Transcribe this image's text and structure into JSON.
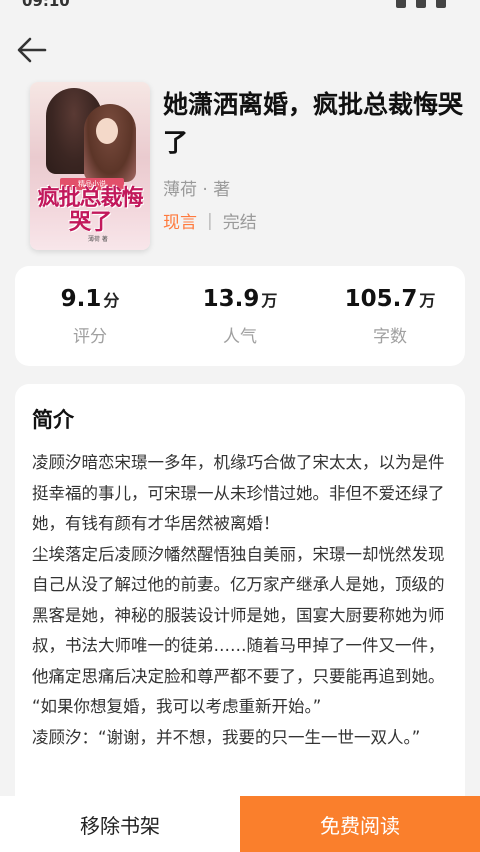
{
  "status_bar": {
    "time": "09:10"
  },
  "book": {
    "title": "她潇洒离婚，疯批总裁悔哭了",
    "author": "薄荷 · 著",
    "genre": "现言",
    "separator": "|",
    "status": "完结",
    "cover": {
      "badge": "精品小说",
      "title": "疯批总裁悔哭了",
      "author": "薄荷 著"
    }
  },
  "stats": [
    {
      "value": "9.1",
      "unit": "分",
      "label": "评分"
    },
    {
      "value": "13.9",
      "unit": "万",
      "label": "人气"
    },
    {
      "value": "105.7",
      "unit": "万",
      "label": "字数"
    }
  ],
  "intro": {
    "heading": "简介",
    "paragraphs": [
      "凌顾汐暗恋宋璟一多年，机缘巧合做了宋太太，以为是件挺幸福的事儿，可宋璟一从未珍惜过她。非但不爱还绿了她，有钱有颜有才华居然被离婚！",
      "尘埃落定后凌顾汐幡然醒悟独自美丽，宋璟一却恍然发现自己从没了解过他的前妻。亿万家产继承人是她，顶级的黑客是她，神秘的服装设计师是她，国宴大厨要称她为师叔，书法大师唯一的徒弟……随着马甲掉了一件又一件，他痛定思痛后决定脸和尊严都不要了，只要能再追到她。",
      "“如果你想复婚，我可以考虑重新开始。”",
      "凌顾汐：“谢谢，并不想，我要的只一生一世一双人。”"
    ]
  },
  "actions": {
    "remove_label": "移除书架",
    "read_label": "免费阅读"
  },
  "colors": {
    "accent": "#fa7f2c",
    "genre_tag": "#ff7a3d",
    "background": "#f3f3f3"
  }
}
